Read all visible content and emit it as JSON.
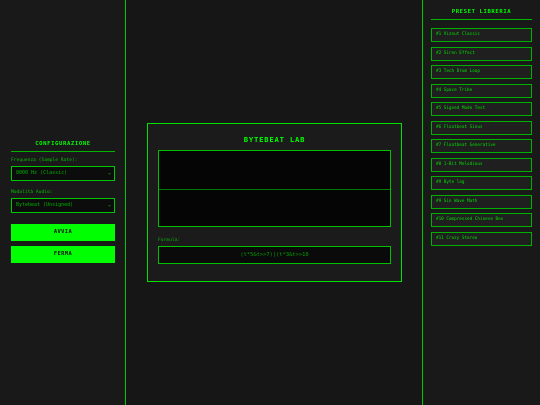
{
  "config": {
    "title": "CONFIGURAZIONE",
    "sample_rate_label": "Frequenza (Sample Rate):",
    "sample_rate_value": "8000 Hz (Classic)",
    "mode_label": "Modalità Audio:",
    "mode_value": "Bytebeat (Unsigned)",
    "play_label": "AVVIA",
    "stop_label": "FERMA"
  },
  "lab": {
    "title": "BYTEBEAT LAB",
    "formula_label": "Formula:",
    "formula_value": "(t*5&t>>7)|(t*3&t>>10"
  },
  "presets": {
    "title": "PRESET LIBRERIA",
    "items": [
      "#1 Viznut Classic",
      "#2 Siren Effect",
      "#3 Tech Drum Loop",
      "#4 Space Tribe",
      "#5 Signed Mode Test",
      "#6 Floatbeat Sinus",
      "#7 Floatbeat Generative",
      "#8 1-Bit Melodious",
      "#9 Byte lag",
      "#9 Sin Wave Math",
      "#10 Compressed Chinese Bex",
      "#11 Crazy Stereo"
    ]
  },
  "colors": {
    "accent": "#00ff00",
    "background": "#171717"
  }
}
